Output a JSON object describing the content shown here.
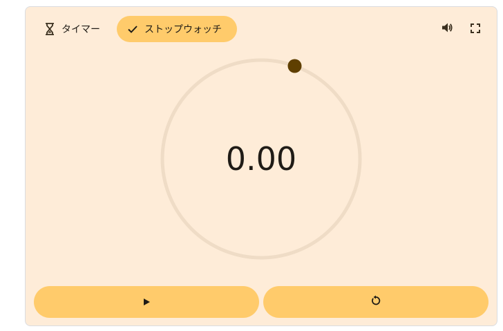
{
  "tabs": {
    "timer_label": "タイマー",
    "stopwatch_label": "ストップウォッチ"
  },
  "stopwatch": {
    "display": "0.00"
  },
  "icons": {
    "timer_tab": "hourglass-icon",
    "stopwatch_tab": "check-icon",
    "sound": "volume-icon",
    "fullscreen": "fullscreen-icon",
    "play": "play-icon",
    "reset": "reset-icon"
  },
  "colors": {
    "card_background": "#feecd8",
    "accent": "#ffcb6b",
    "dial_track": "#efdcc6",
    "dial_knob": "#5f3f00",
    "text": "#1f1b16"
  }
}
